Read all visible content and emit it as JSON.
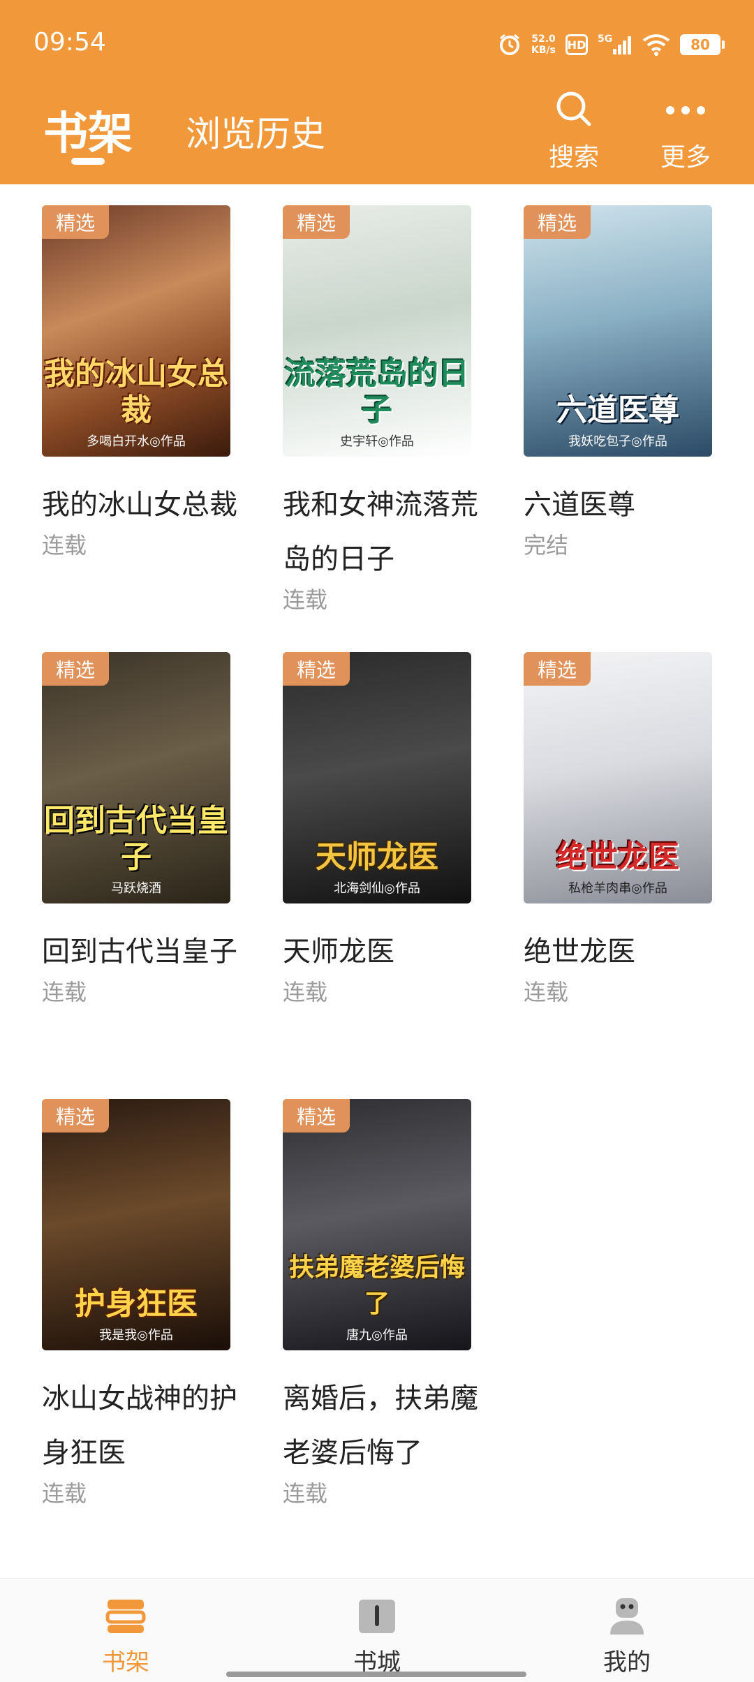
{
  "status_bar": {
    "time": "09:54",
    "net_speed_value": "52.0",
    "net_speed_unit": "KB/s",
    "hd": "HD",
    "network": "5G",
    "battery": "80"
  },
  "header": {
    "tab_active": "书架",
    "tab_inactive": "浏览历史",
    "search_label": "搜索",
    "more_label": "更多"
  },
  "books": [
    {
      "title": "我的冰山女总裁",
      "status": "连载",
      "badge": "精选",
      "cover_title": "我的冰山女总裁",
      "cover_author": "多喝白开水◎作品"
    },
    {
      "title": "我和女神流落荒岛的日子",
      "status": "连载",
      "badge": "精选",
      "cover_title": "流落荒岛的日子",
      "cover_author": "史宇轩◎作品"
    },
    {
      "title": "六道医尊",
      "status": "完结",
      "badge": "精选",
      "cover_title": "六道医尊",
      "cover_author": "我妖吃包子◎作品"
    },
    {
      "title": "回到古代当皇子",
      "status": "连载",
      "badge": "精选",
      "cover_title": "回到古代当皇子",
      "cover_author": "马跃烧酒"
    },
    {
      "title": "天师龙医",
      "status": "连载",
      "badge": "精选",
      "cover_title": "天师龙医",
      "cover_author": "北海剑仙◎作品"
    },
    {
      "title": "绝世龙医",
      "status": "连载",
      "badge": "精选",
      "cover_title": "绝世龙医",
      "cover_author": "私枪羊肉串◎作品"
    },
    {
      "title": "冰山女战神的护身狂医",
      "status": "连载",
      "badge": "精选",
      "cover_title": "护身狂医",
      "cover_author": "我是我◎作品"
    },
    {
      "title": "离婚后，扶弟魔老婆后悔了",
      "status": "连载",
      "badge": "精选",
      "cover_title": "扶弟魔老婆后悔了",
      "cover_author": "唐九◎作品"
    }
  ],
  "bottom_nav": {
    "bookshelf": "书架",
    "bookstore": "书城",
    "mine": "我的"
  },
  "colors": {
    "accent": "#F0983A",
    "badge": "#E0925A",
    "nav_active": "#F0983A",
    "nav_inactive": "#333333"
  }
}
